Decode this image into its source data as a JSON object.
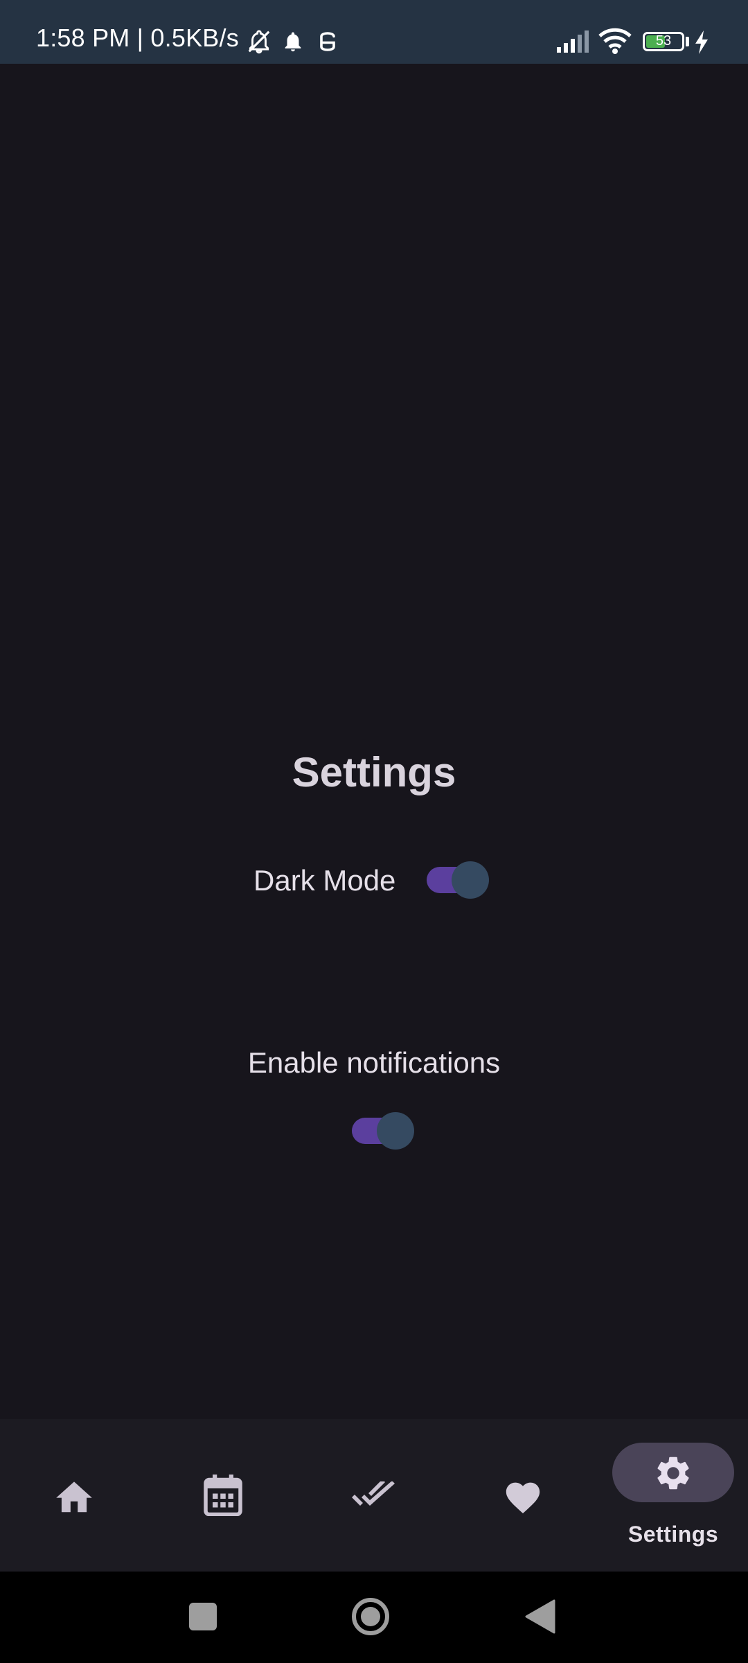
{
  "status_bar": {
    "time_net": "1:58 PM | 0.5KB/s",
    "battery_level": "53",
    "battery_percent": 53,
    "icons": [
      "bell-off-icon",
      "bell-icon",
      "vpn-icon",
      "signal-icon",
      "wifi-icon",
      "battery-icon",
      "charging-icon"
    ]
  },
  "settings": {
    "title": "Settings",
    "dark_mode_label": "Dark Mode",
    "dark_mode_on": true,
    "notifications_label": "Enable notifications",
    "notifications_on": true
  },
  "bottom_nav": {
    "items": [
      {
        "icon": "home-icon"
      },
      {
        "icon": "calendar-icon"
      },
      {
        "icon": "done-all-icon"
      },
      {
        "icon": "heart-icon"
      },
      {
        "icon": "gear-icon",
        "label": "Settings",
        "selected": true
      }
    ]
  },
  "system_nav": {
    "icons": [
      "recents-icon",
      "home-circle-icon",
      "back-icon"
    ]
  },
  "colors": {
    "background": "#17151c",
    "status_bar": "#253343",
    "switch_track": "#5b3f9e",
    "switch_thumb": "#354a61",
    "nav_pill": "#4a4458"
  }
}
